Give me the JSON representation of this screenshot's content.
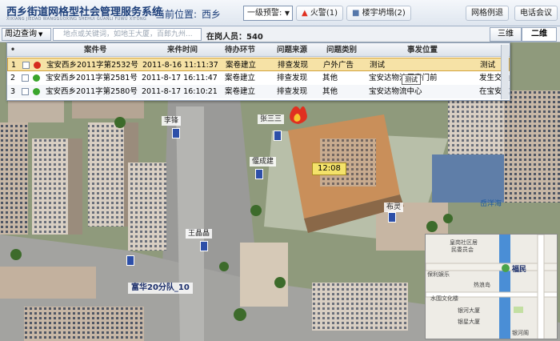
{
  "header": {
    "title": "西乡街道网格型社会管理服务系统",
    "subtitle": "XIXIANG JIEDAO WANGGUOXING SHEHUI GUANLI FUWU XITONG",
    "location_label": "当前位置:",
    "location_value": "西乡",
    "alert_select": "一级预警:",
    "fire_label": "火警(1)",
    "collapse_label": "楼宇坍塌(2)",
    "grid_btn": "网格例退",
    "conf_btn": "电话会议"
  },
  "toolbar": {
    "search_btn": "周边查询",
    "search_placeholder": "地点或关键词，如地王大厦，百郎九州...",
    "online_label": "在岗人员：540",
    "btn_3d": "三维",
    "btn_2d": "二维"
  },
  "table": {
    "headers": [
      "案件号",
      "来件时间",
      "待办环节",
      "问题来源",
      "问题类别",
      "事发位置"
    ],
    "rows": [
      {
        "idx": "1",
        "status": "red",
        "case": "宝安西乡2011字第2532号",
        "time": "2011-8-16 11:11:37",
        "step": "案卷建立",
        "source": "排查发现",
        "category": "户外广告",
        "location": "测试",
        "extra": "测试"
      },
      {
        "idx": "2",
        "status": "green",
        "case": "宝安西乡2011字第2581号",
        "time": "2011-8-17 16:11:47",
        "step": "案卷建立",
        "source": "排查发现",
        "category": "其他",
        "location": "宝安达物流厂房门前",
        "extra": "发生交通"
      },
      {
        "idx": "3",
        "status": "green",
        "case": "宝安西乡2011字第2580号",
        "time": "2011-8-17 16:10:21",
        "step": "案卷建立",
        "source": "排查发现",
        "category": "其他",
        "location": "宝安达物流中心",
        "extra": "在宝安达"
      }
    ],
    "tooltip": "测试"
  },
  "map": {
    "labels": {
      "p1": "李锋",
      "p2": "张三三",
      "p3": "偃成建",
      "p4": "王晶晶",
      "p5": "布灵",
      "p6": "岳洋海"
    },
    "fire_time": "12:08",
    "squad": "富华20分队_10"
  },
  "minimap": {
    "t1": "皇岗社区居",
    "t2": "民委员会",
    "t3": "福民",
    "t4": "热浪岛",
    "t5": "水围文化楼",
    "t6": "银河大厦",
    "t7": "银星大厦",
    "t8": "保利娱乐",
    "t9": "银河阁"
  },
  "colors": {
    "accent": "#1d3f7a",
    "fire": "#e03020",
    "highlight_row": "#f6e2a6"
  }
}
